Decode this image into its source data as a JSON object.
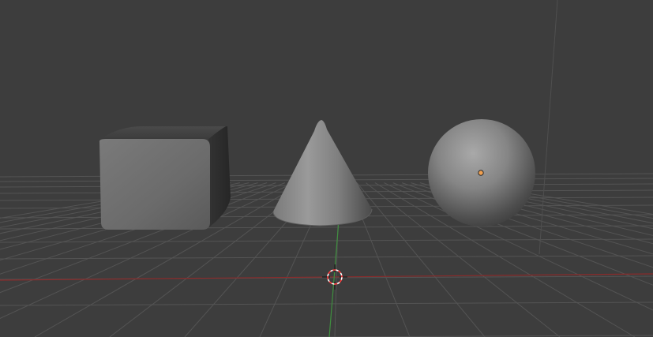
{
  "viewport": {
    "background": "#3d3d3d",
    "grid_color": "#545454",
    "x_axis_color": "#8a2b2b",
    "y_axis_color": "#3f8f3f"
  },
  "scene": {
    "objects": [
      {
        "name": "cube",
        "kind": "mesh",
        "icon": "cube-icon",
        "selected": false
      },
      {
        "name": "cone",
        "kind": "mesh",
        "icon": "cone-icon",
        "selected": false
      },
      {
        "name": "sphere",
        "kind": "mesh",
        "icon": "sphere-icon",
        "selected": false
      }
    ],
    "origin_marker_color": "#f0a050",
    "cursor": {
      "icon": "3d-cursor-icon",
      "colors": [
        "#ff3b3b",
        "#ffffff"
      ]
    }
  }
}
